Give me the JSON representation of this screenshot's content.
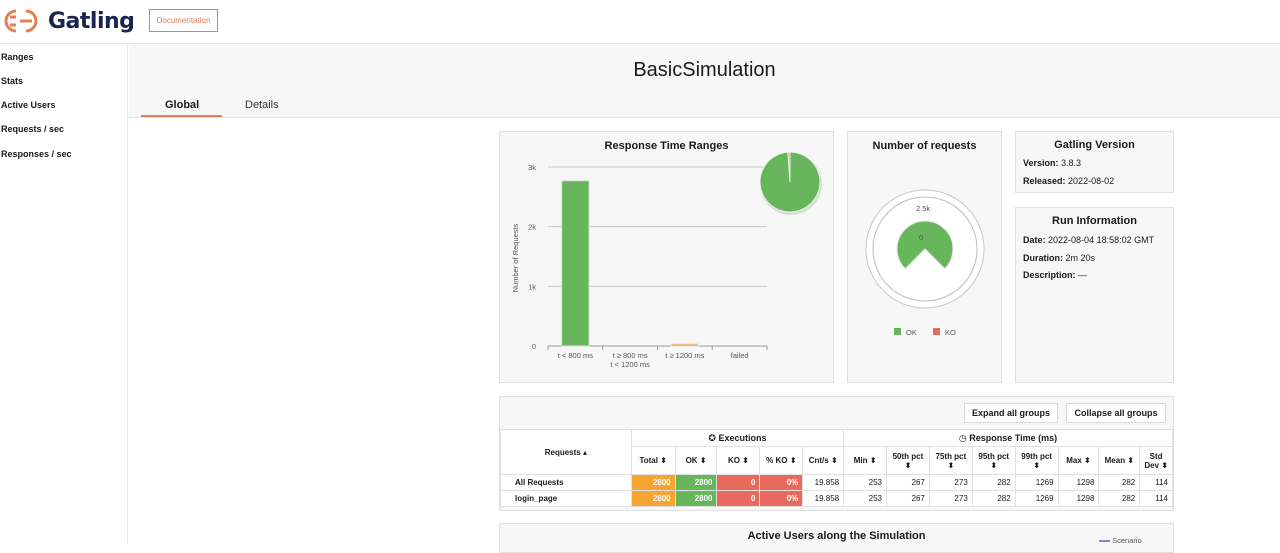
{
  "app": {
    "name": "Gatling",
    "doc_label": "Documentation"
  },
  "sidebar": {
    "items": [
      {
        "label": "Ranges"
      },
      {
        "label": "Stats"
      },
      {
        "label": "Active Users"
      },
      {
        "label": "Requests / sec"
      },
      {
        "label": "Responses / sec"
      }
    ]
  },
  "simulation": {
    "title": "BasicSimulation"
  },
  "tabs": [
    {
      "label": "Global"
    },
    {
      "label": "Details"
    }
  ],
  "colors": {
    "ok": "#68b65c",
    "ko": "#e86a5f",
    "total": "#f5a530",
    "accent": "#e37f55"
  },
  "ranges_card": {
    "title": "Response Time Ranges",
    "ylabel": "Number of Requests",
    "yticks": [
      "0",
      "1k",
      "2k",
      "3k"
    ],
    "cat_labels": [
      [
        "t < 800 ms"
      ],
      [
        "t ≥ 800 ms",
        "t < 1200 ms"
      ],
      [
        "t ≥ 1200 ms"
      ],
      [
        "failed"
      ]
    ]
  },
  "requests_card": {
    "title": "Number of requests",
    "gauge_max_label": "2.5k",
    "gauge_center_label": "0",
    "legend": [
      {
        "label": "OK"
      },
      {
        "label": "KO"
      }
    ]
  },
  "version_card": {
    "title": "Gatling Version",
    "version_label": "Version:",
    "version": "3.8.3",
    "released_label": "Released:",
    "released": "2022-08-02"
  },
  "run_card": {
    "title": "Run Information",
    "date_label": "Date:",
    "date": "2022-08-04 18:58:02 GMT",
    "duration_label": "Duration:",
    "duration": "2m 20s",
    "description_label": "Description:",
    "description": "—"
  },
  "stats": {
    "expand_label": "Expand all groups",
    "collapse_label": "Collapse all groups",
    "requests_header": "Requests",
    "executions_header": "Executions",
    "response_time_header": "Response Time (ms)",
    "columns": [
      "Total",
      "OK",
      "KO",
      "% KO",
      "Cnt/s",
      "Min",
      "50th pct",
      "75th pct",
      "95th pct",
      "99th pct",
      "Max",
      "Mean",
      "Std Dev"
    ],
    "rows": [
      {
        "name": "All Requests",
        "values": [
          "2800",
          "2800",
          "0",
          "0%",
          "19.858",
          "253",
          "267",
          "273",
          "282",
          "1269",
          "1298",
          "282",
          "114"
        ]
      },
      {
        "name": "login_page",
        "values": [
          "2800",
          "2800",
          "0",
          "0%",
          "19.858",
          "253",
          "267",
          "273",
          "282",
          "1269",
          "1298",
          "282",
          "114"
        ]
      }
    ]
  },
  "active_users": {
    "title": "Active Users along the Simulation",
    "legend": "Scenario"
  },
  "chart_data": [
    {
      "type": "bar",
      "title": "Response Time Ranges",
      "ylabel": "Number of Requests",
      "categories": [
        "t < 800 ms",
        "t ≥ 800 ms t < 1200 ms",
        "t ≥ 1200 ms",
        "failed"
      ],
      "values": [
        2770,
        0,
        30,
        0
      ],
      "ylim": [
        0,
        3000
      ],
      "grid": true
    },
    {
      "type": "pie",
      "title": "Response Time Ranges",
      "categories": [
        "t < 800 ms",
        "t ≥ 1200 ms"
      ],
      "values": [
        98.9,
        1.1
      ]
    }
  ]
}
